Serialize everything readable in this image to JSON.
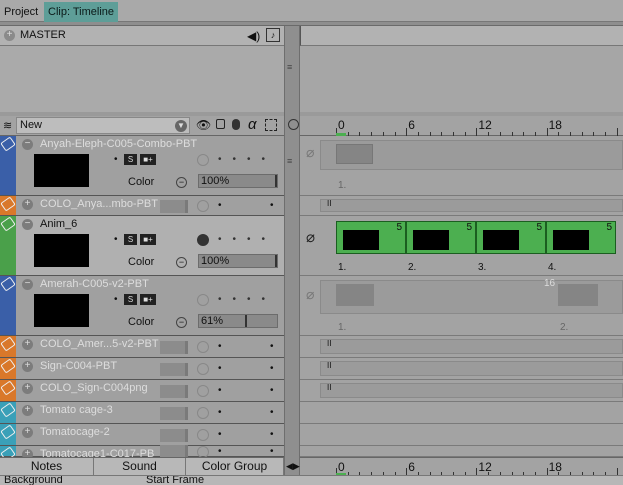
{
  "tabs": [
    {
      "label": "Project",
      "active": false
    },
    {
      "label": "Clip: Timeline",
      "active": true
    }
  ],
  "master": {
    "label": "MASTER"
  },
  "header": {
    "new_label": "New",
    "alpha_glyph": "α"
  },
  "layers": [
    {
      "name": "Anyah-Eleph-C005-Combo-PBT",
      "type": "group",
      "tag_color": "#3a5fa8",
      "selected": false,
      "color_label": "Color",
      "opacity_pct": "100%",
      "opacity": 1.0
    },
    {
      "name": "COLO_Anya...mbo-PBT",
      "type": "small",
      "tag_color": "#d9782a",
      "selected": false
    },
    {
      "name": "Anim_6",
      "type": "group",
      "tag_color": "#4aa04a",
      "selected": true,
      "color_label": "Color",
      "opacity_pct": "100%",
      "opacity": 1.0
    },
    {
      "name": "Amerah-C005-v2-PBT",
      "type": "group",
      "tag_color": "#3a5fa8",
      "selected": false,
      "color_label": "Color",
      "opacity_pct": "61%",
      "opacity": 0.61
    },
    {
      "name": "COLO_Amer...5-v2-PBT",
      "type": "small",
      "tag_color": "#d9782a",
      "selected": false
    },
    {
      "name": "Sign-C004-PBT",
      "type": "small",
      "tag_color": "#d9782a",
      "selected": false
    },
    {
      "name": "COLO_Sign-C004png",
      "type": "small",
      "tag_color": "#d9782a",
      "selected": false
    },
    {
      "name": "Tomato cage-3",
      "type": "small",
      "tag_color": "#3aa0b8",
      "selected": false
    },
    {
      "name": "Tomatocage-2",
      "type": "small",
      "tag_color": "#3aa0b8",
      "selected": false
    },
    {
      "name": "Tomatocage1-C017-PB",
      "type": "small",
      "tag_color": "#3aa0b8",
      "selected": false
    }
  ],
  "ruler": {
    "labels": [
      "0",
      "6",
      "12",
      "18"
    ]
  },
  "timeline": {
    "anim_frames": [
      {
        "num": "5",
        "label": "1."
      },
      {
        "num": "5",
        "label": "2."
      },
      {
        "num": "5",
        "label": "3."
      },
      {
        "num": "5",
        "label": "4."
      }
    ],
    "anyah_label": "1.",
    "amerah_label_1": "1.",
    "amerah_label_2": "2.",
    "amerah_num": "16"
  },
  "bottom_tabs": {
    "notes": "Notes",
    "sound": "Sound",
    "color_group": "Color Group"
  },
  "status": {
    "left": "Background",
    "right": "Start Frame"
  },
  "colors": {
    "accent_tab": "#5e9e98",
    "green_cel": "#4caf50",
    "blue_tag": "#3a5fa8",
    "orange_tag": "#d9782a",
    "teal_tag": "#3aa0b8"
  }
}
